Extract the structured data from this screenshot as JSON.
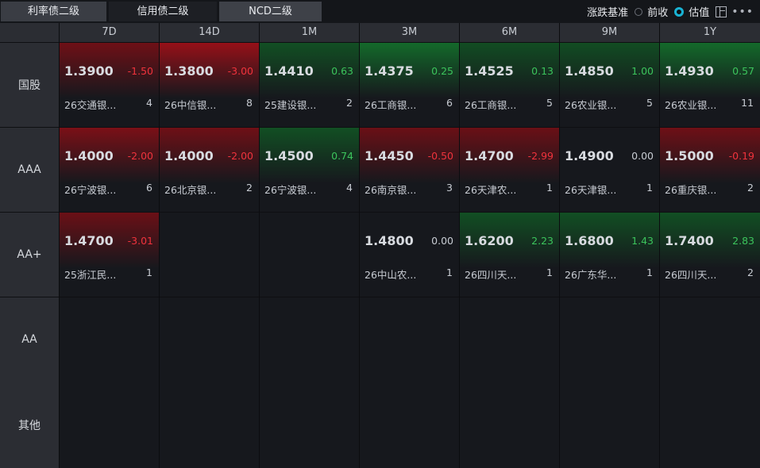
{
  "tabs": [
    "利率债二级",
    "信用债二级",
    "NCD二级"
  ],
  "basis": {
    "label": "涨跌基准",
    "options": [
      "前收",
      "估值"
    ],
    "selected": "估值"
  },
  "icons": [
    "layout-icon",
    "more-icon"
  ],
  "colors": {
    "up": "#3cc45c",
    "down": "#f0333c",
    "accent": "#19b3d4"
  },
  "columns": [
    "7D",
    "14D",
    "1M",
    "3M",
    "6M",
    "9M",
    "1Y"
  ],
  "rows": [
    {
      "label": "国股",
      "cells": [
        {
          "rate": "1.3900",
          "change": "-1.50",
          "dir": "down",
          "level": 0.55,
          "name": "26交通银...",
          "count": "4"
        },
        {
          "rate": "1.3800",
          "change": "-3.00",
          "dir": "down",
          "level": 1.0,
          "name": "26中信银...",
          "count": "8"
        },
        {
          "rate": "1.4410",
          "change": "0.63",
          "dir": "up",
          "level": 0.45,
          "name": "25建设银...",
          "count": "2"
        },
        {
          "rate": "1.4375",
          "change": "0.25",
          "dir": "up",
          "level": 0.85,
          "name": "26工商银...",
          "count": "6"
        },
        {
          "rate": "1.4525",
          "change": "0.13",
          "dir": "up",
          "level": 0.4,
          "name": "26工商银...",
          "count": "5"
        },
        {
          "rate": "1.4850",
          "change": "1.00",
          "dir": "up",
          "level": 0.4,
          "name": "26农业银...",
          "count": "5"
        },
        {
          "rate": "1.4930",
          "change": "0.57",
          "dir": "up",
          "level": 0.85,
          "name": "26农业银...",
          "count": "11"
        }
      ]
    },
    {
      "label": "AAA",
      "cells": [
        {
          "rate": "1.4000",
          "change": "-2.00",
          "dir": "down",
          "level": 0.7,
          "name": "26宁波银...",
          "count": "6"
        },
        {
          "rate": "1.4000",
          "change": "-2.00",
          "dir": "down",
          "level": 0.55,
          "name": "26北京银...",
          "count": "2"
        },
        {
          "rate": "1.4500",
          "change": "0.74",
          "dir": "up",
          "level": 0.45,
          "name": "26宁波银...",
          "count": "4"
        },
        {
          "rate": "1.4450",
          "change": "-0.50",
          "dir": "down",
          "level": 0.5,
          "name": "26南京银...",
          "count": "3"
        },
        {
          "rate": "1.4700",
          "change": "-2.99",
          "dir": "down",
          "level": 0.5,
          "name": "26天津农...",
          "count": "1"
        },
        {
          "rate": "1.4900",
          "change": "0.00",
          "dir": "flat",
          "level": 0.0,
          "name": "26天津银...",
          "count": "1"
        },
        {
          "rate": "1.5000",
          "change": "-0.19",
          "dir": "down",
          "level": 0.55,
          "name": "26重庆银...",
          "count": "2"
        }
      ]
    },
    {
      "label": "AA+",
      "cells": [
        {
          "rate": "1.4700",
          "change": "-3.01",
          "dir": "down",
          "level": 0.5,
          "name": "25浙江民...",
          "count": "1"
        },
        null,
        null,
        {
          "rate": "1.4800",
          "change": "0.00",
          "dir": "flat",
          "level": 0.0,
          "name": "26中山农...",
          "count": "1"
        },
        {
          "rate": "1.6200",
          "change": "2.23",
          "dir": "up",
          "level": 0.45,
          "name": "26四川天...",
          "count": "1"
        },
        {
          "rate": "1.6800",
          "change": "1.43",
          "dir": "up",
          "level": 0.45,
          "name": "26广东华...",
          "count": "1"
        },
        {
          "rate": "1.7400",
          "change": "2.83",
          "dir": "up",
          "level": 0.45,
          "name": "26四川天...",
          "count": "2"
        }
      ]
    },
    {
      "label": "AA",
      "cells": [
        null,
        null,
        null,
        null,
        null,
        null,
        null
      ]
    },
    {
      "label": "其他",
      "cells": [
        null,
        null,
        null,
        null,
        null,
        null,
        null
      ]
    }
  ]
}
